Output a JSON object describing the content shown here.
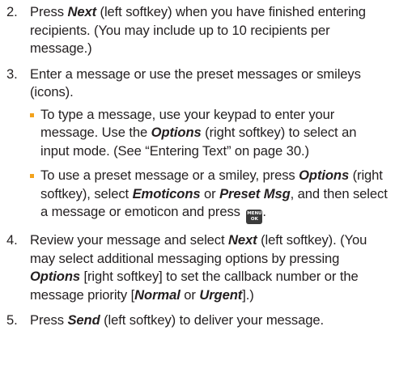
{
  "steps": [
    {
      "number": "2.",
      "text_a": "Press ",
      "em_next": "Next",
      "text_b": " (left softkey) when you have finished entering recipients. (You may include up to 10 recipients per message.)"
    },
    {
      "number": "3.",
      "text": "Enter a message or use the preset messages or smileys (icons).",
      "bullets": [
        {
          "text_a": "To type a message, use your keypad to enter your message. Use the ",
          "em_options": "Options",
          "text_b": " (right softkey) to select an input mode. (See “Entering Text” on page 30.)"
        },
        {
          "text_a": "To use a preset message or a smiley, press ",
          "em_options": "Options",
          "text_b": " (right softkey), select ",
          "em_emoticons": "Emoticons",
          "text_c": " or ",
          "em_preset": "Preset Msg",
          "text_d": ", and then select a message or emoticon and press "
        }
      ]
    },
    {
      "number": "4.",
      "text_a": "Review your message and select ",
      "em_next": "Next",
      "text_b": " (left softkey). (You may select additional messaging options by pressing ",
      "em_options": "Options",
      "text_c": " [right softkey] to set the callback number or the message priority [",
      "em_normal": "Normal",
      "text_d": " or ",
      "em_urgent": "Urgent",
      "text_e": "].)"
    },
    {
      "number": "5.",
      "text_a": "Press ",
      "em_send": "Send",
      "text_b": " (left softkey) to deliver your message."
    }
  ],
  "menu_key": {
    "line1": "MENU",
    "line2": "OK",
    "icon": "menu-ok-key-icon"
  },
  "colors": {
    "text": "#231f20",
    "bullet": "#f3a21c",
    "key_background": "#3b3b3b"
  }
}
